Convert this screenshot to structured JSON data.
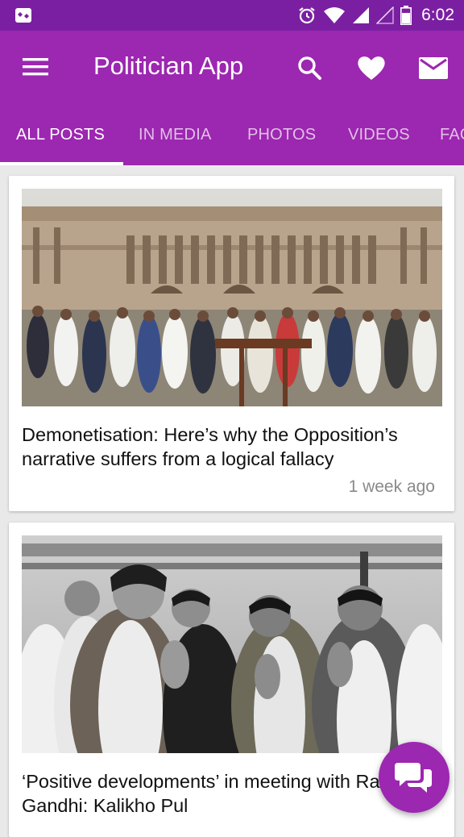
{
  "status_bar": {
    "time": "6:02",
    "icons": [
      "notification-app-icon",
      "alarm-icon",
      "wifi-icon",
      "signal-icon",
      "signal-empty-icon",
      "battery-icon"
    ]
  },
  "app_bar": {
    "title": "Politician App",
    "actions": [
      "search-icon",
      "heart-icon",
      "mail-icon"
    ]
  },
  "tabs": [
    {
      "label": "ALL POSTS",
      "active": true
    },
    {
      "label": "IN MEDIA",
      "active": false
    },
    {
      "label": "PHOTOS",
      "active": false
    },
    {
      "label": "VIDEOS",
      "active": false
    },
    {
      "label": "FAQ",
      "active": false
    }
  ],
  "posts": [
    {
      "headline": "Demonetisation: Here’s why the Opposition’s narrative suffers from a logical fallacy",
      "time_ago": "1 week ago"
    },
    {
      "headline": "‘Positive developments’ in meeting with Rahul Gandhi: Kalikho Pul",
      "time_ago": ""
    }
  ],
  "fab": {
    "icon": "chat-icon"
  },
  "colors": {
    "primary": "#9c27b0",
    "primary_dark": "#7b1fa2",
    "background": "#e9e9e9"
  }
}
